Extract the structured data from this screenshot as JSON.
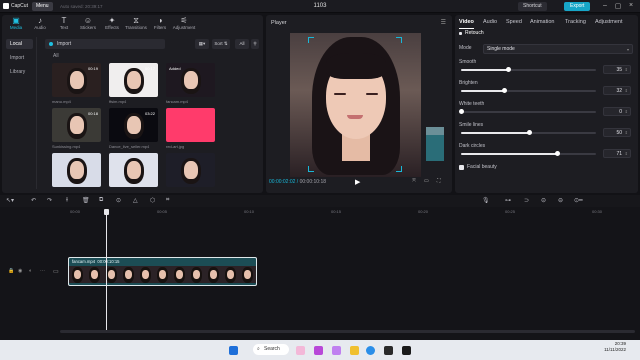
{
  "app": {
    "name": "CapCut",
    "menu_label": "Menu",
    "saved_status": "Auto saved: 20:39:17",
    "project_title": "1103",
    "shortcut_label": "Shortcut",
    "export_label": "Export"
  },
  "media": {
    "toolbar": [
      {
        "label": "Media",
        "icon": "media-icon",
        "glyph": "▣"
      },
      {
        "label": "Audio",
        "icon": "audio-icon",
        "glyph": "♪"
      },
      {
        "label": "Text",
        "icon": "text-icon",
        "glyph": "T"
      },
      {
        "label": "Stickers",
        "icon": "sticker-icon",
        "glyph": "☺"
      },
      {
        "label": "Effects",
        "icon": "effects-icon",
        "glyph": "✦"
      },
      {
        "label": "Transitions",
        "icon": "transitions-icon",
        "glyph": "⧖"
      },
      {
        "label": "Filters",
        "icon": "filters-icon",
        "glyph": "◑"
      },
      {
        "label": "Adjustment",
        "icon": "adjustment-icon",
        "glyph": "⚟"
      }
    ],
    "sidebar": [
      {
        "label": "Local"
      },
      {
        "label": "Import"
      },
      {
        "label": "Library"
      }
    ],
    "import_label": "Import",
    "sort_label": "Sort",
    "filter_label": "All",
    "all_label": "All",
    "items": [
      {
        "name": "manu.mp4",
        "duration": "00:19",
        "added": ""
      },
      {
        "name": "ffsim.mp4",
        "duration": "00:17",
        "added": ""
      },
      {
        "name": "fancam.mp4",
        "duration": "",
        "added": "Added"
      },
      {
        "name": "Sunkissing.mp4",
        "duration": "00:18",
        "added": ""
      },
      {
        "name": "Dance_live_seller.mp4",
        "duration": "03:22",
        "added": ""
      },
      {
        "name": "red-art.jpg",
        "duration": "",
        "added": ""
      },
      {
        "name": "",
        "duration": "",
        "added": ""
      },
      {
        "name": "",
        "duration": "",
        "added": ""
      },
      {
        "name": "",
        "duration": "",
        "added": ""
      }
    ]
  },
  "player": {
    "title": "Player",
    "current_time": "00:00:02:02",
    "total_time": "00:00:10:18",
    "ratio_label": "Ratio"
  },
  "inspector": {
    "tabs": [
      "Video",
      "Audio",
      "Speed",
      "Animation",
      "Tracking",
      "Adjustment"
    ],
    "section": "Retouch",
    "mode_label": "Mode",
    "mode_value": "Single mode",
    "sliders": [
      {
        "label": "Smooth",
        "value": 35
      },
      {
        "label": "Brighten",
        "value": 32
      },
      {
        "label": "White teeth",
        "value": 0
      },
      {
        "label": "Smile lines",
        "value": 50
      },
      {
        "label": "Dark circles",
        "value": 71
      }
    ],
    "facial_beauty_label": "Facial beauty"
  },
  "timeline": {
    "ruler": [
      "00:00",
      "00:05",
      "00:10",
      "00:15",
      "00:20",
      "00:25",
      "00:30"
    ],
    "clip_name": "fancam.mp4",
    "clip_duration": "00:00:10:15",
    "frame_count": 11
  },
  "taskbar": {
    "search_label": "Search",
    "time": "20:39",
    "date": "11/11/2022"
  }
}
